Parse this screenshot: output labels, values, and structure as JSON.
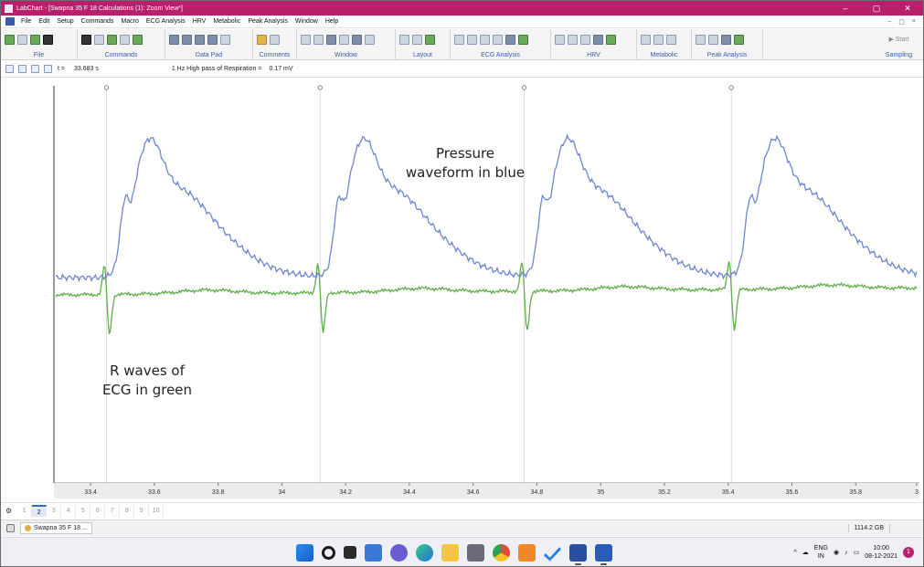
{
  "window": {
    "title": "LabChart - [Swapna 35 F 18 Calculations (1): Zoom View*]",
    "controls": {
      "minimize": "–",
      "maximize": "▢",
      "close": "✕"
    },
    "accent": "#b8206e"
  },
  "menubar": {
    "items": [
      "File",
      "Edit",
      "Setup",
      "Commands",
      "Macro",
      "ECG Analysis",
      "HRV",
      "Metabolic",
      "Peak Analysis",
      "Window",
      "Help"
    ],
    "right_controls": [
      "–",
      "▢",
      "×"
    ]
  },
  "ribbon": {
    "groups": [
      "File",
      "Commands",
      "Data Pad",
      "Comments",
      "Window",
      "Layout",
      "ECG Analysis",
      "HRV",
      "Metabolic",
      "Peak Analysis",
      "Sampling"
    ],
    "start_button": "▶ Start"
  },
  "toolbar2": {
    "time_label": "t =",
    "time_value": "33.683 s",
    "filter_label": "1 Hz High pass of Respiration =",
    "filter_value": "0.17 mV"
  },
  "plot": {
    "pressure_color": "#6f86cf",
    "ecg_color": "#5fae4a",
    "annotation_pressure": [
      "Pressure",
      "waveform in blue"
    ],
    "annotation_ecg": [
      "R waves of",
      "ECG in green"
    ],
    "x_ticks": [
      "33.4",
      "33.6",
      "33.8",
      "34",
      "34.2",
      "34.4",
      "34.6",
      "34.8",
      "35",
      "35.2",
      "35.4",
      "35.6",
      "35.8",
      "3"
    ],
    "marker_times": [
      33.45,
      34.12,
      34.76,
      35.41
    ]
  },
  "pagebar": {
    "pages": [
      "1",
      "2",
      "3",
      "4",
      "5",
      "6",
      "7",
      "8",
      "9",
      "10"
    ],
    "active_page": "2"
  },
  "statusbar": {
    "document": "Swapna 35 F 18 ...",
    "disk_space": "1114.2 GB"
  },
  "taskbar": {
    "lang_top": "ENG",
    "lang_bottom": "IN",
    "time": "10:00",
    "date": "08-12-2021",
    "notifications": "1"
  }
}
